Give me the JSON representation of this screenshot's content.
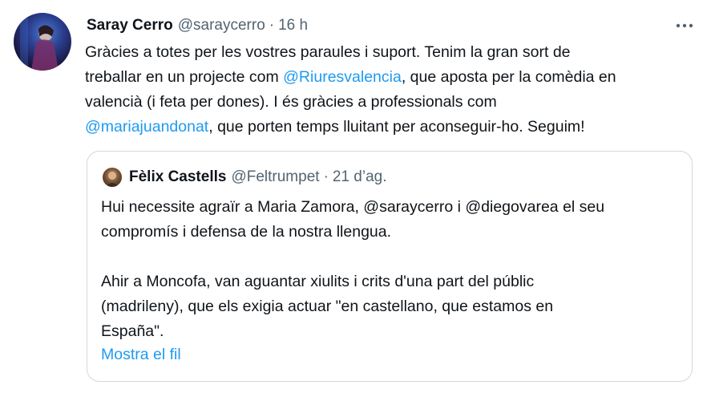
{
  "tweet": {
    "author_name": "Saray Cerro",
    "author_handle": "@saraycerro",
    "separator": "·",
    "time": "16 h",
    "body": {
      "line1": "Gràcies a totes per les vostres paraules i suport. Tenim la gran sort de",
      "line2_pre": "treballar en un projecte com ",
      "line2_link": "@Riuresvalencia",
      "line2_post": ", que aposta per la comèdia en",
      "line3": "valencià (i feta per dones). I és gràcies a professionals com",
      "line4_link": "@mariajuandonat",
      "line4_post": ", que porten temps lluitant per aconseguir-ho. Seguim!"
    }
  },
  "quote": {
    "author_name": "Fèlix Castells",
    "author_handle": "@Feltrumpet",
    "separator": "·",
    "time": "21 d’ag.",
    "lines": [
      "Hui necessite agraïr a Maria Zamora, @saraycerro i @diegovarea el seu",
      "compromís i defensa de la nostra llengua.",
      "Ahir a Moncofa, van aguantar xiulits i crits d'una part del públic",
      "(madrileny), que els exigia actuar \"en castellano, que estamos en",
      "España\"."
    ],
    "show_thread": "Mostra el fil"
  },
  "colors": {
    "text": "#0f1419",
    "secondary": "#536471",
    "link": "#1d9bf0",
    "border": "#cfd9de"
  },
  "icons": {
    "more": "more-dots-icon"
  }
}
